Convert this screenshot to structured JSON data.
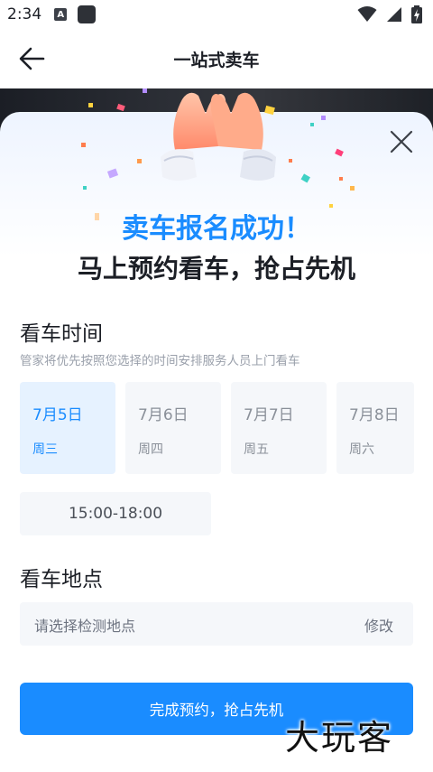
{
  "status_bar": {
    "time": "2:34",
    "a_icon_letter": "A"
  },
  "app_bar": {
    "title": "一站式卖车"
  },
  "success": {
    "title": "卖车报名成功！",
    "subtitle": "马上预约看车，抢占先机"
  },
  "viewing_time": {
    "title": "看车时间",
    "hint": "管家将优先按照您选择的时间安排服务人员上门看车",
    "dates": [
      {
        "day": "7月5日",
        "week": "周三",
        "selected": true
      },
      {
        "day": "7月6日",
        "week": "周四",
        "selected": false
      },
      {
        "day": "7月7日",
        "week": "周五",
        "selected": false
      },
      {
        "day": "7月8日",
        "week": "周六",
        "selected": false
      }
    ],
    "time_slot": "15:00-18:00"
  },
  "viewing_location": {
    "title": "看车地点",
    "placeholder": "请选择检测地点",
    "edit_label": "修改"
  },
  "submit_label": "完成预约，抢占先机",
  "watermark": "大玩客",
  "colors": {
    "accent": "#1a8cff",
    "selected_bg": "#e6f2ff",
    "card_bg": "#f5f7fa"
  }
}
